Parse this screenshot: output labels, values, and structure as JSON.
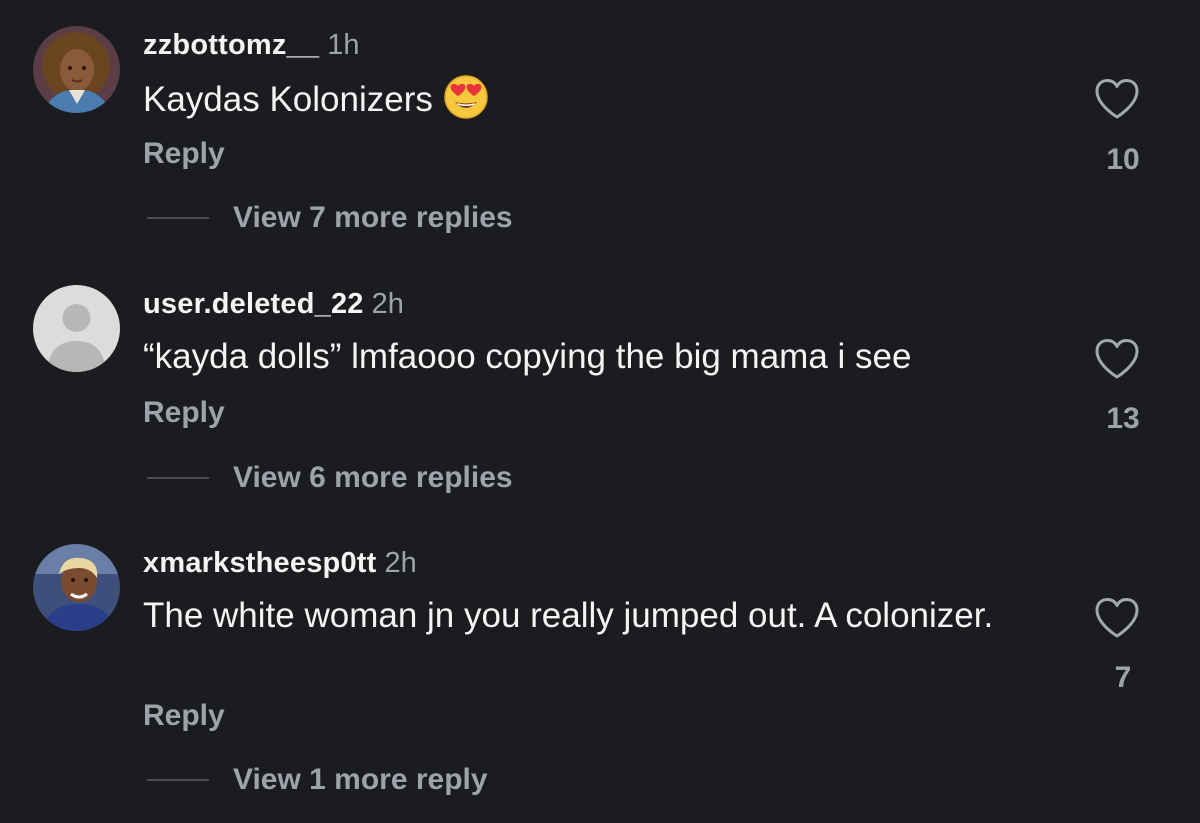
{
  "comments": [
    {
      "username": "zzbottomz__",
      "time": "1h",
      "text": "Kaydas Kolonizers",
      "emoji": "heart-eyes-face",
      "reply_label": "Reply",
      "likes": "10",
      "view_more": "View 7 more replies"
    },
    {
      "username": "user.deleted_22",
      "time": "2h",
      "text": "“kayda dolls” lmfaooo copying the big mama i see",
      "reply_label": "Reply",
      "likes": "13",
      "view_more": "View 6 more replies"
    },
    {
      "username": "xmarkstheesp0tt",
      "time": "2h",
      "text": "The white woman jn you really jumped out. A colonizer.",
      "reply_label": "Reply",
      "likes": "7",
      "view_more": "View 1 more reply"
    }
  ],
  "colors": {
    "background": "#1b1c1f",
    "primary_text": "#f4f4f4",
    "secondary_text": "#9ea3ab",
    "divider": "#4a4d54"
  },
  "icons": {
    "like": "heart-outline-icon",
    "avatar_default": "default-user-icon"
  }
}
